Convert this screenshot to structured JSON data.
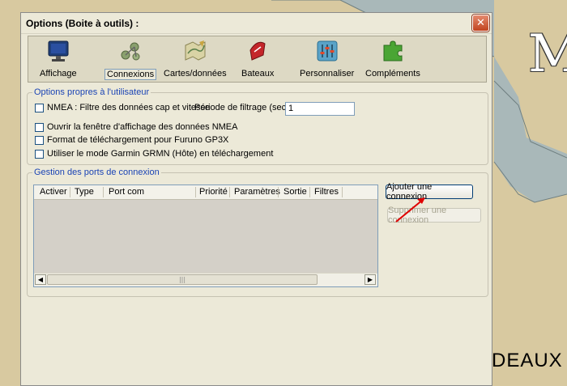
{
  "window": {
    "title": "Options (Boite à outils) :"
  },
  "toolbar": {
    "items": [
      {
        "label": "Affichage",
        "icon": "monitor-icon"
      },
      {
        "label": "Connexions",
        "icon": "network-icon",
        "selected": true
      },
      {
        "label": "Cartes/données",
        "icon": "map-icon"
      },
      {
        "label": "Bateaux",
        "icon": "boat-icon"
      },
      {
        "label": "Personnaliser",
        "icon": "sliders-icon"
      },
      {
        "label": "Compléments",
        "icon": "puzzle-icon"
      }
    ]
  },
  "user_options": {
    "legend": "Options propres à l'utilisateur",
    "nmea_filter_label": "NMEA : Filtre des données cap et vitesse",
    "period_label": "Période de filtrage (sec.)",
    "period_value": "1",
    "open_nmea_window_label": "Ouvrir la fenêtre d'affichage des données NMEA",
    "furuno_label": "Format de téléchargement pour Furuno GP3X",
    "garmin_label": "Utiliser le mode Garmin GRMN (Hôte) en téléchargement"
  },
  "ports": {
    "legend": "Gestion des ports de connexion",
    "columns": [
      "Activer",
      "Type",
      "Port com",
      "Priorité",
      "Paramètres",
      "Sortie",
      "Filtres"
    ],
    "rows": [],
    "add_button": "Ajouter une connexion",
    "remove_button": "Supprimer une connexion"
  },
  "map": {
    "letter": "M",
    "text": "DEAUX"
  }
}
